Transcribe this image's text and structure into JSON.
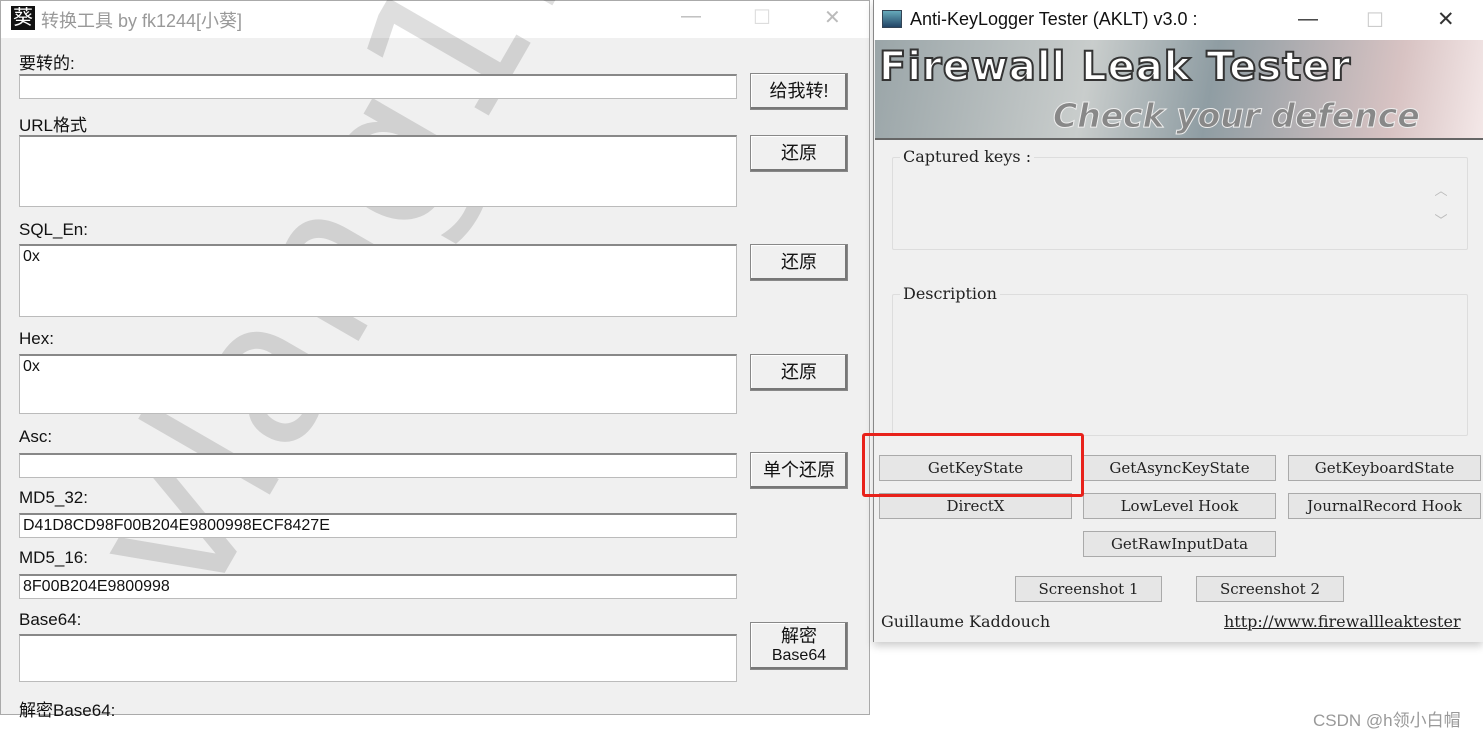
{
  "left_window": {
    "icon_char": "葵",
    "title": "转换工具 by fk1244[小葵]",
    "controls": {
      "minimize": "—",
      "maximize": "☐",
      "close": "✕"
    },
    "watermark": "vlang11",
    "fields": {
      "input": {
        "label": "要转的:",
        "value": "",
        "button": "给我转!"
      },
      "url": {
        "label": "URL格式",
        "value": "",
        "button": "还原"
      },
      "sql": {
        "label": "SQL_En:",
        "value": "0x",
        "button": "还原"
      },
      "hex": {
        "label": "Hex:",
        "value": "0x",
        "button": "还原"
      },
      "asc": {
        "label": "Asc:",
        "value": "",
        "button": "单个还原"
      },
      "md5_32": {
        "label": "MD5_32:",
        "value": "D41D8CD98F00B204E9800998ECF8427E"
      },
      "md5_16": {
        "label": "MD5_16:",
        "value": "8F00B204E9800998"
      },
      "base64": {
        "label": "Base64:",
        "value": "",
        "button_line1": "解密",
        "button_line2": "Base64"
      },
      "decoded_base64": {
        "label": "解密Base64:"
      }
    }
  },
  "right_window": {
    "title": "Anti-KeyLogger Tester (AKLT) v3.0 :",
    "controls": {
      "minimize": "—",
      "maximize": "☐",
      "close": "✕"
    },
    "banner": {
      "title": "Firewall Leak Tester",
      "subtitle": "Check your defence"
    },
    "captured_keys_label": "Captured keys :",
    "description_label": "Description",
    "buttons": [
      "GetKeyState",
      "GetAsyncKeyState",
      "GetKeyboardState",
      "DirectX",
      "LowLevel Hook",
      "JournalRecord Hook",
      "GetRawInputData"
    ],
    "screenshot_buttons": [
      "Screenshot 1",
      "Screenshot 2"
    ],
    "author": "Guillaume Kaddouch",
    "link": "http://www.firewallleaktester",
    "highlight_color": "#e8221b"
  },
  "csdn_watermark": "CSDN @h领小白帽"
}
